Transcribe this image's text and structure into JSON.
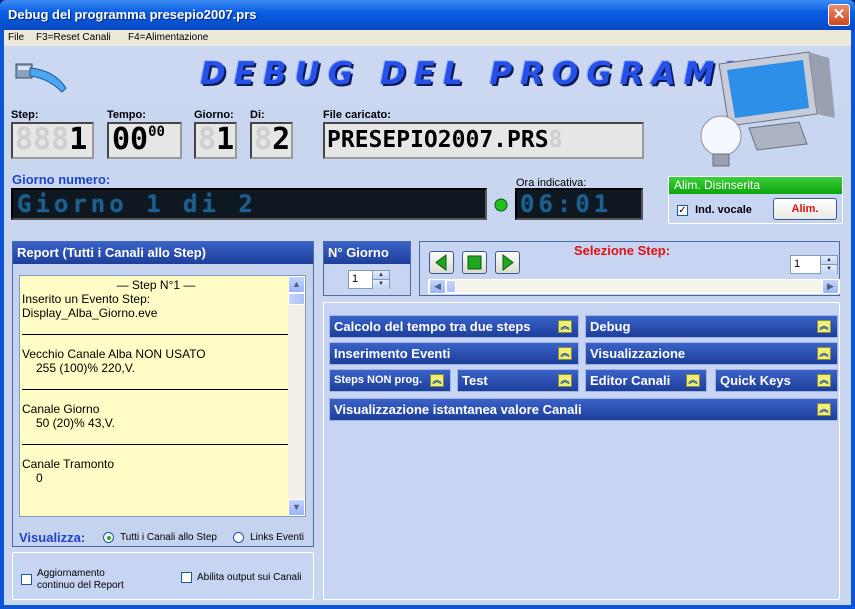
{
  "window": {
    "title": "Debug del programma presepio2007.prs",
    "close_label": "✕"
  },
  "menu": {
    "items": [
      "File",
      "F3=Reset Canali",
      "F4=Alimentazione"
    ]
  },
  "header": {
    "banner": "DEBUG DEL PROGRAMMA"
  },
  "counters": {
    "step_label": "Step:",
    "step_ghost": "888",
    "step_value": "1",
    "tempo_label": "Tempo:",
    "tempo_main": "00",
    "tempo_sup": "00",
    "giorno_label": "Giorno:",
    "giorno_ghost": "8",
    "giorno_value": "1",
    "di_label": "Di:",
    "di_ghost": "8",
    "di_value": "2",
    "file_label": "File caricato:",
    "file_value": "PRESEPIO2007.PRS",
    "file_ghost": "8"
  },
  "giorno_numero": {
    "label": "Giorno numero:",
    "display": "Giorno 1 di 2"
  },
  "ora": {
    "label": "Ora indicativa:",
    "display": "06:01"
  },
  "alim": {
    "header": "Alim. Disinserita",
    "vocale_label": "Ind. vocale",
    "vocale_checked": "✓",
    "button": "Alim."
  },
  "report": {
    "title": "Report (Tutti i Canali allo Step)",
    "step_header": "— Step N°1 —",
    "lines": [
      "Inserito un Evento Step:",
      "Display_Alba_Giorno.eve",
      "Vecchio Canale Alba NON USATO",
      "255  (100)% 220,V.",
      "Canale Giorno",
      "50  (20)% 43,V.",
      "Canale Tramonto",
      "0"
    ],
    "visualizza_label": "Visualizza:",
    "radio_all": "Tutti i Canali allo Step",
    "radio_links": "Links Eventi"
  },
  "options": {
    "aggiornamento_line1": "Aggiornamento",
    "aggiornamento_line2": "continuo del Report",
    "abilita": "Abilita output sui Canali"
  },
  "ngiorno": {
    "title": "N° Giorno",
    "value": "1"
  },
  "selezione": {
    "title": "Selezione Step:",
    "value": "1"
  },
  "panel_buttons": {
    "calcolo": "Calcolo del tempo tra due steps",
    "debug": "Debug",
    "inserimento": "Inserimento Eventi",
    "visualizzazione": "Visualizzazione",
    "steps_non_prog": "Steps NON prog.",
    "test": "Test",
    "editor": "Editor Canali",
    "quick": "Quick Keys",
    "istantanea": "Visualizzazione istantanea valore Canali"
  },
  "colors": {
    "titlebar": "#0a5fe0",
    "banner": "#2750e8",
    "alim_header": "#0da50d",
    "red": "#e01010"
  }
}
